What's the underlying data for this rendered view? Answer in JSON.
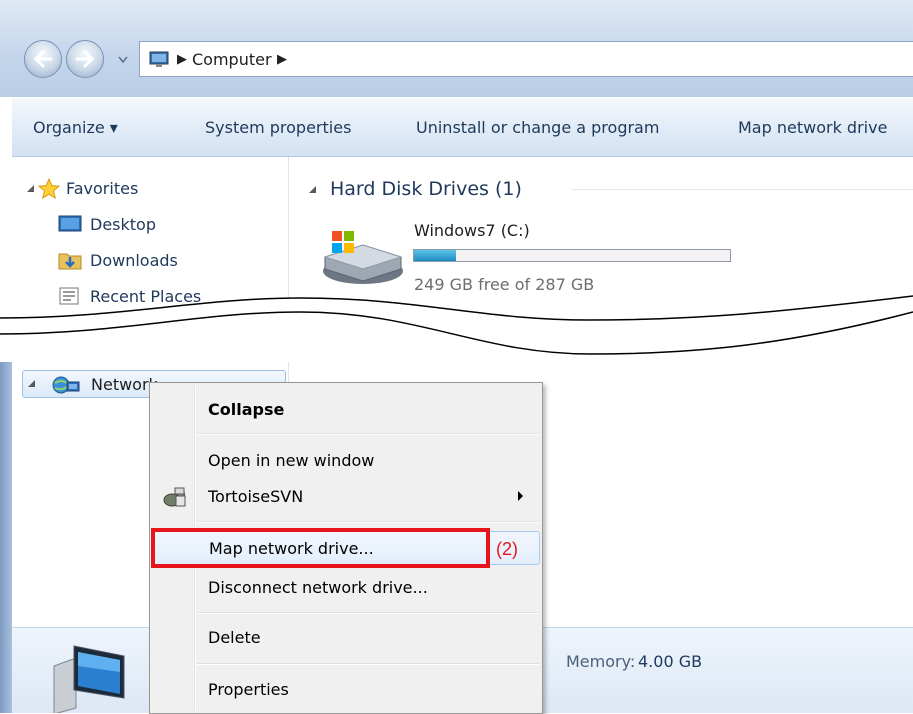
{
  "address": {
    "location": "Computer"
  },
  "toolbar": {
    "organize": "Organize ▾",
    "system_properties": "System properties",
    "uninstall": "Uninstall or change a program",
    "map_drive": "Map network drive"
  },
  "navigation": {
    "favorites": "Favorites",
    "desktop": "Desktop",
    "downloads": "Downloads",
    "recent_places": "Recent Places",
    "network": "Network"
  },
  "content": {
    "group_header": "Hard Disk Drives (1)",
    "drive": {
      "name": "Windows7 (C:)",
      "free_text": "249 GB free of 287 GB",
      "used_fraction": 0.132
    }
  },
  "context_menu": {
    "items": [
      {
        "label": "Collapse"
      },
      {
        "label": "Open in new window"
      },
      {
        "label": "TortoiseSVN"
      },
      {
        "label": "Map network drive..."
      },
      {
        "label": "Disconnect network drive..."
      },
      {
        "label": "Delete"
      },
      {
        "label": "Properties"
      }
    ]
  },
  "annotation": {
    "step": "(2)"
  },
  "details": {
    "memory_label": "Memory:",
    "memory_value": "4.00 GB"
  },
  "colors": {
    "highlight": "#e8141b",
    "accent": "#1e395b"
  }
}
